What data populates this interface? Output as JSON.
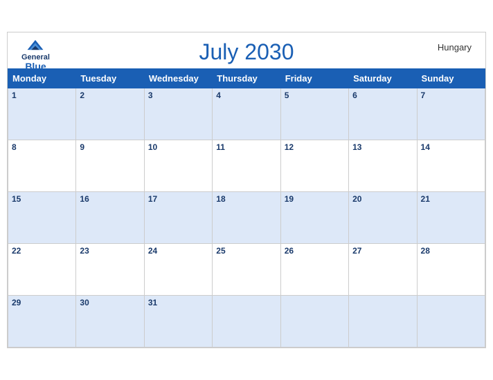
{
  "header": {
    "title": "July 2030",
    "country": "Hungary",
    "logo": {
      "line1": "General",
      "line2": "Blue"
    }
  },
  "weekdays": [
    "Monday",
    "Tuesday",
    "Wednesday",
    "Thursday",
    "Friday",
    "Saturday",
    "Sunday"
  ],
  "weeks": [
    [
      1,
      2,
      3,
      4,
      5,
      6,
      7
    ],
    [
      8,
      9,
      10,
      11,
      12,
      13,
      14
    ],
    [
      15,
      16,
      17,
      18,
      19,
      20,
      21
    ],
    [
      22,
      23,
      24,
      25,
      26,
      27,
      28
    ],
    [
      29,
      30,
      31,
      null,
      null,
      null,
      null
    ]
  ]
}
